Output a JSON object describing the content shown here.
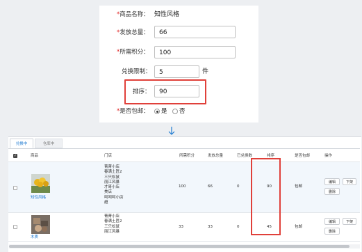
{
  "form": {
    "product_name": {
      "label": "商品名称：",
      "value": "知性风格"
    },
    "total_issued": {
      "label": "发放总量：",
      "value": "66"
    },
    "points_required": {
      "label": "所需积分：",
      "value": "100"
    },
    "redeem_limit": {
      "label": "兑换限制：",
      "value": "5",
      "unit": "件"
    },
    "sort_order": {
      "label": "排序：",
      "value": "90"
    },
    "free_shipping": {
      "label": "是否包邮：",
      "options": [
        "是",
        "否"
      ],
      "selected": "是"
    },
    "required_mark": "*"
  },
  "tabs": [
    "兑换中",
    "仓库中"
  ],
  "table": {
    "headers": [
      "商品",
      "门店",
      "所需积分",
      "发放总量",
      "已兑换数",
      "排序",
      "是否包邮",
      "操作"
    ],
    "rows": [
      {
        "product": "知性风格",
        "stores": [
          "菁菁小店",
          "春满土匠2",
          "三只松鼠",
          "丽江风暴",
          "才哥小店",
          "美店",
          "呵呵呵小店",
          "超"
        ],
        "points": "100",
        "total": "66",
        "redeemed": "0",
        "sort": "90",
        "shipping": "包邮",
        "actions": [
          "编辑",
          "下架",
          "删除"
        ]
      },
      {
        "product": "木质",
        "stores": [
          "菁菁小店",
          "春满土匠2",
          "三只松鼠",
          "丽江风暴"
        ],
        "points": "33",
        "total": "33",
        "redeemed": "0",
        "sort": "45",
        "shipping": "包邮",
        "actions": [
          "编辑",
          "下架",
          "删除"
        ]
      }
    ]
  },
  "colors": {
    "accent": "#1e7ad1",
    "highlight": "#e0403a",
    "required": "#e02020"
  }
}
